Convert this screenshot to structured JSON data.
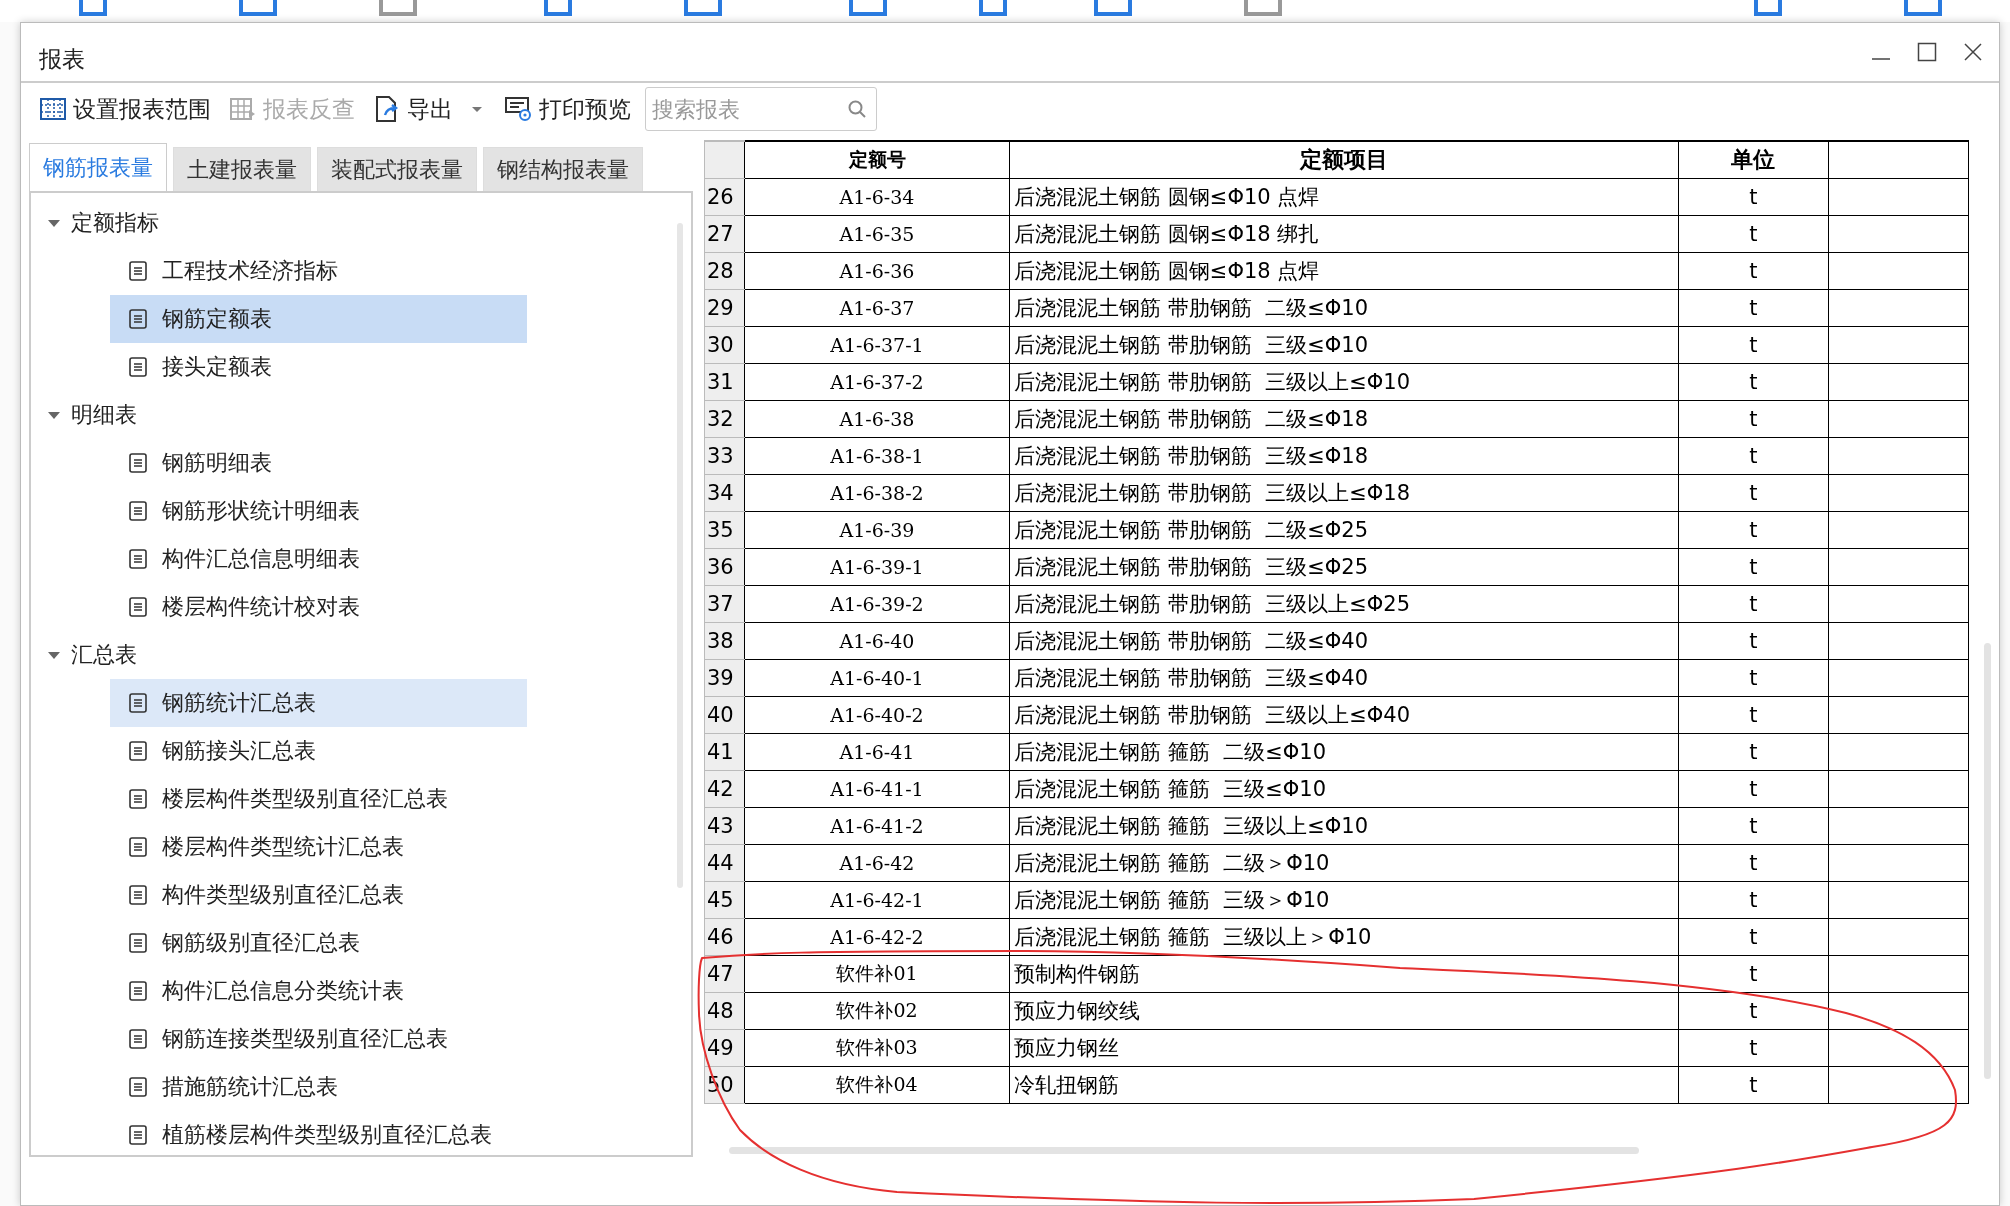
{
  "window": {
    "title": "报表"
  },
  "toolbar": [
    {
      "kind": "range",
      "label": "设置报表范围",
      "disabled": false,
      "has_menu": false
    },
    {
      "kind": "lookup",
      "label": "报表反查",
      "disabled": true,
      "has_menu": false
    },
    {
      "kind": "export",
      "label": "导出",
      "disabled": false,
      "has_menu": true
    },
    {
      "kind": "print",
      "label": "打印预览",
      "disabled": false,
      "has_menu": false
    }
  ],
  "search": {
    "placeholder": "搜索报表"
  },
  "tabs": [
    {
      "label": "钢筋报表量",
      "selected": true
    },
    {
      "label": "土建报表量",
      "selected": false
    },
    {
      "label": "装配式报表量",
      "selected": false
    },
    {
      "label": "钢结构报表量",
      "selected": false
    }
  ],
  "tree": [
    {
      "label": "定额指标",
      "expanded": true,
      "children": [
        {
          "label": "工程技术经济指标",
          "selected": false,
          "hovered": false
        },
        {
          "label": "钢筋定额表",
          "selected": true,
          "hovered": false
        },
        {
          "label": "接头定额表",
          "selected": false,
          "hovered": false
        }
      ]
    },
    {
      "label": "明细表",
      "expanded": true,
      "children": [
        {
          "label": "钢筋明细表",
          "selected": false,
          "hovered": false
        },
        {
          "label": "钢筋形状统计明细表",
          "selected": false,
          "hovered": false
        },
        {
          "label": "构件汇总信息明细表",
          "selected": false,
          "hovered": false
        },
        {
          "label": "楼层构件统计校对表",
          "selected": false,
          "hovered": false
        }
      ]
    },
    {
      "label": "汇总表",
      "expanded": true,
      "children": [
        {
          "label": "钢筋统计汇总表",
          "selected": false,
          "hovered": true
        },
        {
          "label": "钢筋接头汇总表",
          "selected": false,
          "hovered": false
        },
        {
          "label": "楼层构件类型级别直径汇总表",
          "selected": false,
          "hovered": false
        },
        {
          "label": "楼层构件类型统计汇总表",
          "selected": false,
          "hovered": false
        },
        {
          "label": "构件类型级别直径汇总表",
          "selected": false,
          "hovered": false
        },
        {
          "label": "钢筋级别直径汇总表",
          "selected": false,
          "hovered": false
        },
        {
          "label": "构件汇总信息分类统计表",
          "selected": false,
          "hovered": false
        },
        {
          "label": "钢筋连接类型级别直径汇总表",
          "selected": false,
          "hovered": false
        },
        {
          "label": "措施筋统计汇总表",
          "selected": false,
          "hovered": false
        },
        {
          "label": "植筋楼层构件类型级别直径汇总表",
          "selected": false,
          "hovered": false
        }
      ]
    }
  ],
  "table": {
    "columns": [
      "定额号",
      "定额项目",
      "单位"
    ],
    "rows": [
      {
        "number": "26",
        "code": "A1-6-34",
        "item": "后浇混泥土钢筋 圆钢≤Φ10 点焊",
        "unit": "t"
      },
      {
        "number": "27",
        "code": "A1-6-35",
        "item": "后浇混泥土钢筋 圆钢≤Φ18 绑扎",
        "unit": "t"
      },
      {
        "number": "28",
        "code": "A1-6-36",
        "item": "后浇混泥土钢筋 圆钢≤Φ18 点焊",
        "unit": "t"
      },
      {
        "number": "29",
        "code": "A1-6-37",
        "item": "后浇混泥土钢筋 带肋钢筋  二级≤Φ10",
        "unit": "t"
      },
      {
        "number": "30",
        "code": "A1-6-37-1",
        "item": "后浇混泥土钢筋 带肋钢筋  三级≤Φ10",
        "unit": "t"
      },
      {
        "number": "31",
        "code": "A1-6-37-2",
        "item": "后浇混泥土钢筋 带肋钢筋  三级以上≤Φ10",
        "unit": "t"
      },
      {
        "number": "32",
        "code": "A1-6-38",
        "item": "后浇混泥土钢筋 带肋钢筋  二级≤Φ18",
        "unit": "t"
      },
      {
        "number": "33",
        "code": "A1-6-38-1",
        "item": "后浇混泥土钢筋 带肋钢筋  三级≤Φ18",
        "unit": "t"
      },
      {
        "number": "34",
        "code": "A1-6-38-2",
        "item": "后浇混泥土钢筋 带肋钢筋  三级以上≤Φ18",
        "unit": "t"
      },
      {
        "number": "35",
        "code": "A1-6-39",
        "item": "后浇混泥土钢筋 带肋钢筋  二级≤Φ25",
        "unit": "t"
      },
      {
        "number": "36",
        "code": "A1-6-39-1",
        "item": "后浇混泥土钢筋 带肋钢筋  三级≤Φ25",
        "unit": "t"
      },
      {
        "number": "37",
        "code": "A1-6-39-2",
        "item": "后浇混泥土钢筋 带肋钢筋  三级以上≤Φ25",
        "unit": "t"
      },
      {
        "number": "38",
        "code": "A1-6-40",
        "item": "后浇混泥土钢筋 带肋钢筋  二级≤Φ40",
        "unit": "t"
      },
      {
        "number": "39",
        "code": "A1-6-40-1",
        "item": "后浇混泥土钢筋 带肋钢筋  三级≤Φ40",
        "unit": "t"
      },
      {
        "number": "40",
        "code": "A1-6-40-2",
        "item": "后浇混泥土钢筋 带肋钢筋  三级以上≤Φ40",
        "unit": "t"
      },
      {
        "number": "41",
        "code": "A1-6-41",
        "item": "后浇混泥土钢筋 箍筋  二级≤Φ10",
        "unit": "t"
      },
      {
        "number": "42",
        "code": "A1-6-41-1",
        "item": "后浇混泥土钢筋 箍筋  三级≤Φ10",
        "unit": "t"
      },
      {
        "number": "43",
        "code": "A1-6-41-2",
        "item": "后浇混泥土钢筋 箍筋  三级以上≤Φ10",
        "unit": "t"
      },
      {
        "number": "44",
        "code": "A1-6-42",
        "item": "后浇混泥土钢筋 箍筋  二级＞Φ10",
        "unit": "t"
      },
      {
        "number": "45",
        "code": "A1-6-42-1",
        "item": "后浇混泥土钢筋 箍筋  三级＞Φ10",
        "unit": "t"
      },
      {
        "number": "46",
        "code": "A1-6-42-2",
        "item": "后浇混泥土钢筋 箍筋  三级以上＞Φ10",
        "unit": "t"
      },
      {
        "number": "47",
        "code": "软件补01",
        "item": "预制构件钢筋",
        "unit": "t"
      },
      {
        "number": "48",
        "code": "软件补02",
        "item": "预应力钢绞线",
        "unit": "t"
      },
      {
        "number": "49",
        "code": "软件补03",
        "item": "预应力钢丝",
        "unit": "t"
      },
      {
        "number": "50",
        "code": "软件补04",
        "item": "冷轧扭钢筋",
        "unit": "t"
      }
    ]
  }
}
